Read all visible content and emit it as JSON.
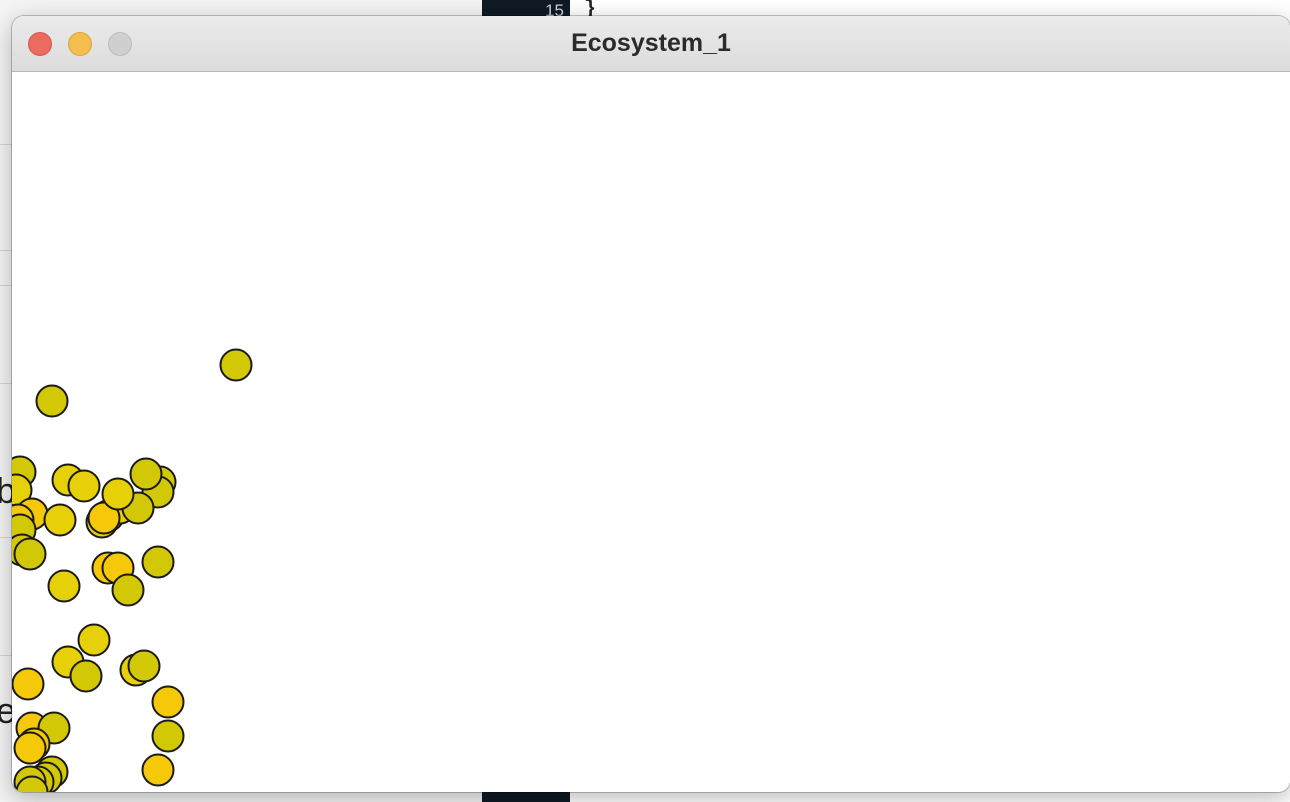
{
  "window": {
    "title": "Ecosystem_1"
  },
  "background": {
    "line_number": "15",
    "code_text": "}",
    "glyph_1": "bi",
    "glyph_2": "ec"
  },
  "colors": {
    "canvas_bg": "#ffffff",
    "creature_fills": [
      "#d2c806",
      "#e6d008",
      "#f5c90a",
      "#c8c80a"
    ],
    "creature_stroke": "#1a1a1a"
  }
}
